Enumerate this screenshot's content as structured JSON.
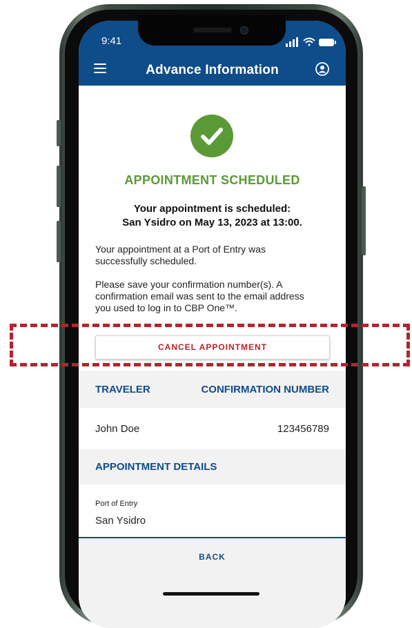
{
  "status_bar": {
    "time": "9:41"
  },
  "header": {
    "title": "Advance Information"
  },
  "confirmation": {
    "title": "APPOINTMENT SCHEDULED",
    "subtitle_line1": "Your appointment is scheduled:",
    "subtitle_line2": "San Ysidro on May 13, 2023 at 13:00.",
    "message1_line1": "Your appointment at a Port of Entry was",
    "message1_line2": "successfully scheduled.",
    "message2_line1": "Please save your confirmation number(s).  A",
    "message2_line2": "confirmation email was sent to the email address",
    "message2_line3": "you used to log in to CBP One™."
  },
  "actions": {
    "cancel_label": "CANCEL APPOINTMENT",
    "back_label": "BACK"
  },
  "table": {
    "headers": [
      "TRAVELER",
      "CONFIRMATION NUMBER"
    ],
    "rows": [
      [
        "John Doe",
        "123456789"
      ]
    ]
  },
  "details": {
    "heading": "APPOINTMENT DETAILS",
    "port_label": "Port of Entry",
    "port_value": "San Ysidro"
  },
  "colors": {
    "brand_blue": "#0e4c8a",
    "success_green": "#5a9a36",
    "danger_red": "#b5242e"
  },
  "icons": [
    "menu-icon",
    "profile-icon",
    "check-icon",
    "signal-icon",
    "wifi-icon",
    "battery-icon"
  ]
}
